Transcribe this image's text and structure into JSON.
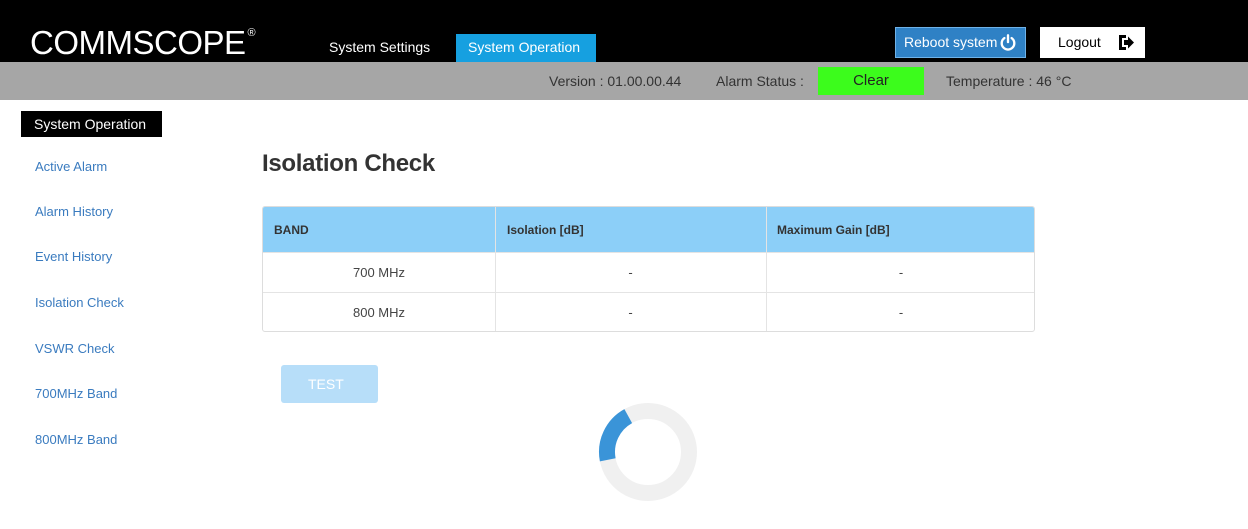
{
  "header": {
    "logo_text": "COMMSCOPE",
    "logo_reg": "®",
    "tabs": [
      {
        "label": "System Settings",
        "active": false
      },
      {
        "label": "System Operation",
        "active": true
      }
    ],
    "reboot_label": "Reboot system",
    "logout_label": "Logout"
  },
  "status": {
    "version": "Version : 01.00.00.44",
    "alarm_label": "Alarm Status :",
    "alarm_value": "Clear",
    "temperature": "Temperature : 46 °C"
  },
  "sidebar": {
    "section_title": "System Operation",
    "items": [
      {
        "label": "Active Alarm"
      },
      {
        "label": "Alarm History"
      },
      {
        "label": "Event History"
      },
      {
        "label": "Isolation Check"
      },
      {
        "label": "VSWR Check"
      },
      {
        "label": "700MHz Band"
      },
      {
        "label": "800MHz Band"
      }
    ]
  },
  "main": {
    "title": "Isolation Check",
    "table": {
      "headers": [
        "BAND",
        "Isolation [dB]",
        "Maximum Gain [dB]"
      ],
      "rows": [
        [
          "700 MHz",
          "-",
          "-"
        ],
        [
          "800 MHz",
          "-",
          "-"
        ]
      ]
    },
    "test_label": "TEST",
    "loading_progress": 0.2
  },
  "colors": {
    "header_bg": "#000000",
    "active_tab": "#16a0e0",
    "status_bar": "#a6a6a6",
    "alarm_clear": "#3cfc1c",
    "table_header": "#8ccff8",
    "link": "#3a7bbf",
    "spinner_arc": "#3a94d8"
  },
  "icons": {
    "reboot": "power-icon",
    "logout": "exit-icon"
  }
}
